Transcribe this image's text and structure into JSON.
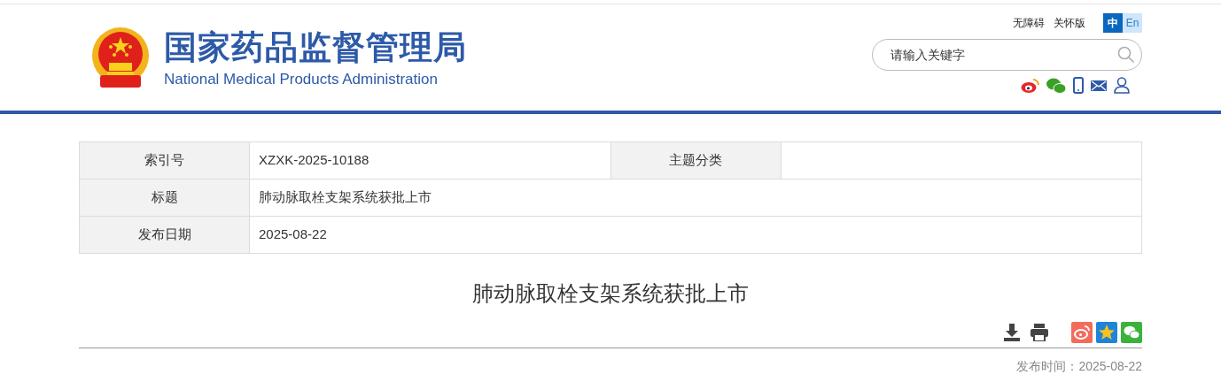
{
  "header": {
    "title": "国家药品监督管理局",
    "subtitle": "National Medical Products Administration",
    "links": [
      "无障碍",
      "关怀版"
    ],
    "languages": [
      {
        "label": "中",
        "selected": true
      },
      {
        "label": "En",
        "selected": false
      }
    ],
    "search": {
      "placeholder": "请输入关键字"
    }
  },
  "info_table": {
    "rows": [
      [
        {
          "label": "索引号",
          "value": "XZXK-2025-10188"
        },
        {
          "label": "主题分类"
        }
      ],
      [
        {
          "label": "标题",
          "value": "肺动脉取栓支架系统获批上市"
        }
      ],
      [
        {
          "label": "发布日期",
          "value": "2025-08-22"
        }
      ]
    ]
  },
  "article": {
    "title": "肺动脉取栓支架系统获批上市",
    "publish_time": "发布时间：2025-08-22"
  }
}
